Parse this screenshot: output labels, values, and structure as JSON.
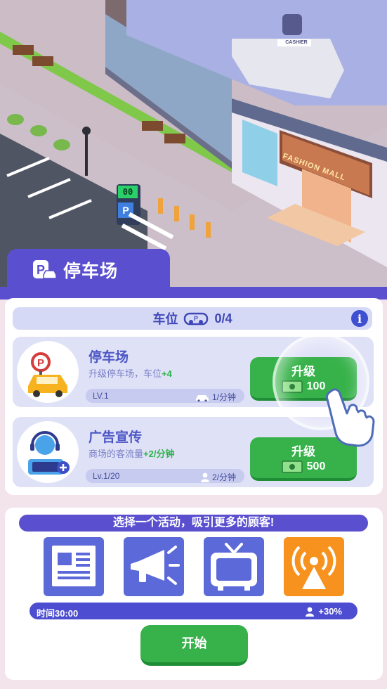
{
  "scene": {
    "parking_counter": "00",
    "parking_sign_letter": "P",
    "mall_sign": "FASHION MALL",
    "cashier_sign": "CASHIER"
  },
  "header": {
    "title": "停车场"
  },
  "slots": {
    "label": "车位",
    "value": "0/4",
    "info_icon": "i"
  },
  "items": [
    {
      "title": "停车场",
      "desc_prefix": "升级停车场，车位",
      "desc_bonus": "+4",
      "level": "LV.1",
      "rate": "1/分钟",
      "rate_icon": "car-icon",
      "button_label": "升级",
      "cost": "100"
    },
    {
      "title": "广告宣传",
      "desc_prefix": "商场的客流量",
      "desc_bonus": "+2/分钟",
      "level": "Lv.1/20",
      "rate": "2/分钟",
      "rate_icon": "person-icon",
      "button_label": "升级",
      "cost": "500"
    }
  ],
  "activity": {
    "banner": "选择一个活动，吸引更多的顾客!",
    "tiles": [
      "newspaper-icon",
      "megaphone-icon",
      "tv-icon",
      "broadcast-tower-icon"
    ],
    "timer": "时间30:00",
    "boost": "+30%",
    "start_label": "开始"
  },
  "colors": {
    "primary_purple": "#5a4fcf",
    "button_green": "#37b24a",
    "tile_blue": "#5b69d9",
    "tile_orange": "#f7921e",
    "bonus_green": "#2eb34a"
  }
}
